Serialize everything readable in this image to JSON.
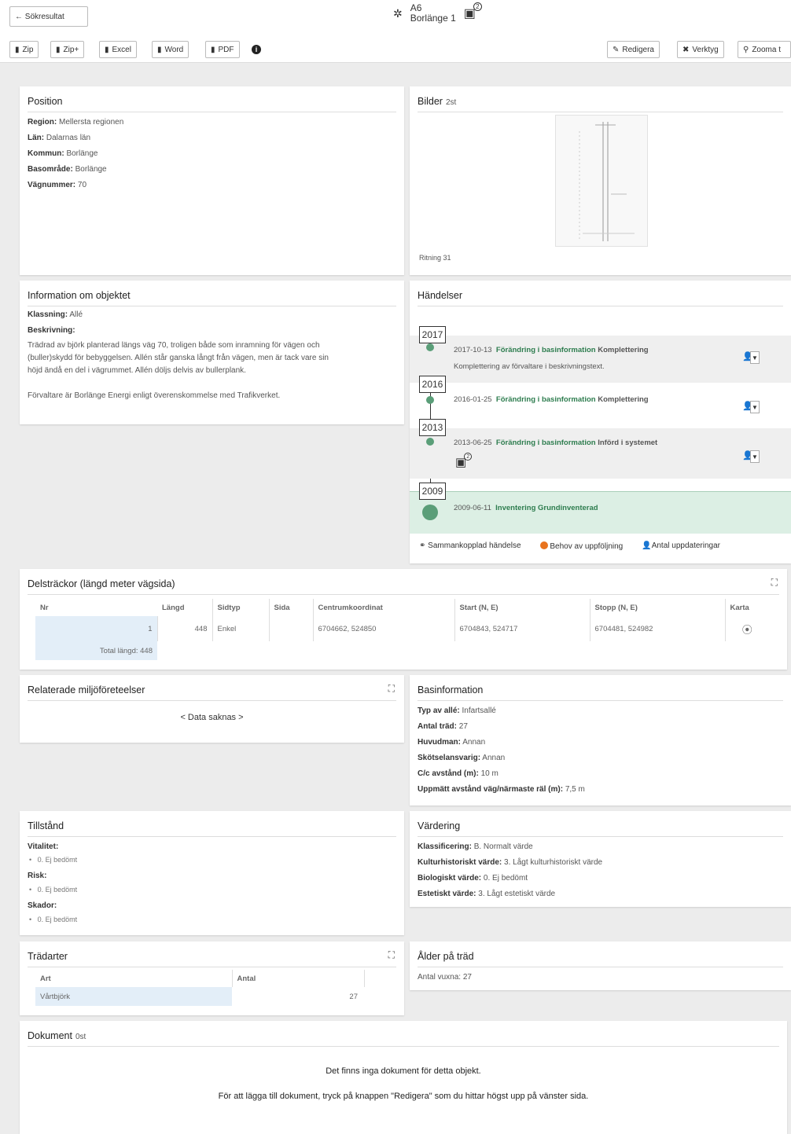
{
  "header": {
    "back_label": "← Sökresultat",
    "object_code": "A6",
    "object_name": "Borlänge 1",
    "image_count": "2"
  },
  "toolbar": {
    "zip": "Zip",
    "zip_plus": "Zip+",
    "excel": "Excel",
    "word": "Word",
    "pdf": "PDF",
    "edit": "Redigera",
    "tools": "Verktyg",
    "zoom": "Zooma t"
  },
  "position": {
    "title": "Position",
    "region_label": "Region:",
    "region": "Mellersta regionen",
    "lan_label": "Län:",
    "lan": "Dalarnas län",
    "kommun_label": "Kommun:",
    "kommun": "Borlänge",
    "basomrade_label": "Basområde:",
    "basomrade": "Borlänge",
    "vagnummer_label": "Vägnummer:",
    "vagnummer": "70"
  },
  "bilder": {
    "title": "Bilder",
    "count": "2st",
    "caption": "Ritning 31"
  },
  "info": {
    "title": "Information om objektet",
    "klassning_label": "Klassning:",
    "klassning": "Allé",
    "beskrivning_label": "Beskrivning:",
    "desc_lines": [
      "Trädrad av björk planterad längs väg 70, troligen både som inramning för vägen och",
      "(buller)skydd för bebyggelsen. Allén står ganska långt från vägen, men är tack vare sin",
      "höjd ändå en del i vägrummet. Allén döljs delvis av bullerplank."
    ],
    "desc_p2": "Förvaltare är Borlänge Energi enligt överenskommelse med Trafikverket."
  },
  "events": {
    "title": "Händelser",
    "items": [
      {
        "year": "2017",
        "date": "2017-10-13",
        "link": "Förändring i basinformation",
        "type": "Komplettering",
        "note": "Komplettering av förvaltare i beskrivningstext.",
        "count": "1"
      },
      {
        "year": "2016",
        "date": "2016-01-25",
        "link": "Förändring i basinformation",
        "type": "Komplettering",
        "note": "",
        "count": "1"
      },
      {
        "year": "2013",
        "date": "2013-06-25",
        "link": "Förändring i basinformation",
        "type": "Införd i systemet",
        "note": "",
        "count": "1",
        "image_count": "2"
      },
      {
        "year": "2009",
        "date": "2009-06-11",
        "link": "Inventering",
        "type": "Grundinventerad",
        "note": ""
      }
    ],
    "legend": {
      "linked": "Sammankopplad händelse",
      "followup": "Behov av uppföljning",
      "updates": "Antal uppdateringar"
    }
  },
  "delstrackor": {
    "title": "Delsträckor (längd meter vägsida)",
    "headers": [
      "Nr",
      "Längd",
      "Sidtyp",
      "Sida",
      "Centrumkoordinat",
      "Start (N, E)",
      "Stopp (N, E)",
      "Karta"
    ],
    "rows": [
      [
        "1",
        "448",
        "Enkel",
        "",
        "6704662, 524850",
        "6704843, 524717",
        "6704481, 524982"
      ]
    ],
    "total": "Total längd: 448"
  },
  "relaterade": {
    "title": "Relaterade miljöföreteelser",
    "empty": "< Data saknas >"
  },
  "basinfo": {
    "title": "Basinformation",
    "items": [
      {
        "label": "Typ av allé:",
        "value": "Infartsallé"
      },
      {
        "label": "Antal träd:",
        "value": "27"
      },
      {
        "label": "Huvudman:",
        "value": "Annan"
      },
      {
        "label": "Skötselansvarig:",
        "value": "Annan"
      },
      {
        "label": "C/c avstånd (m):",
        "value": "10 m"
      },
      {
        "label": "Uppmätt avstånd väg/närmaste räl (m):",
        "value": "7,5 m"
      }
    ]
  },
  "tillstand": {
    "title": "Tillstånd",
    "vitalitet_label": "Vitalitet:",
    "vitalitet": "0. Ej bedömt",
    "risk_label": "Risk:",
    "risk": "0. Ej bedömt",
    "skador_label": "Skador:",
    "skador": "0. Ej bedömt"
  },
  "vardering": {
    "title": "Värdering",
    "items": [
      {
        "label": "Klassificering:",
        "value": "B. Normalt värde"
      },
      {
        "label": "Kulturhistoriskt värde:",
        "value": "3. Lågt kulturhistoriskt värde"
      },
      {
        "label": "Biologiskt värde:",
        "value": "0. Ej bedömt"
      },
      {
        "label": "Estetiskt värde:",
        "value": "3. Lågt estetiskt värde"
      }
    ]
  },
  "tradarter": {
    "title": "Trädarter",
    "col_art": "Art",
    "col_antal": "Antal",
    "art": "Vårtbjörk",
    "antal": "27"
  },
  "alder": {
    "title": "Ålder på träd",
    "label": "Antal vuxna:",
    "value": "27"
  },
  "dokument": {
    "title": "Dokument",
    "count": "0st",
    "empty": "Det finns inga dokument för detta objekt.",
    "hint": "För att lägga till dokument, tryck på knappen \"Redigera\" som du hittar högst upp på vänster sida."
  }
}
